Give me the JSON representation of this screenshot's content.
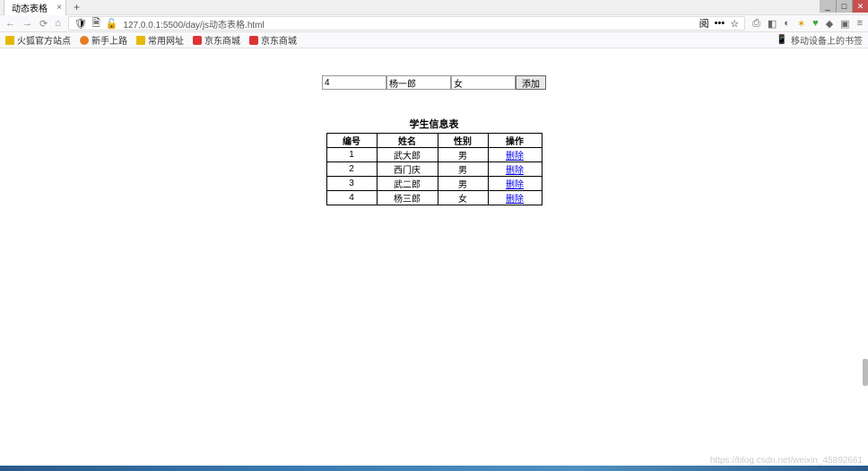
{
  "window": {
    "tab_title": "动态表格"
  },
  "browser": {
    "url": "127.0.0.1:5500/day/js动态表格.html",
    "reader_icon": "阅",
    "ellipsis": "•••",
    "star": "☆",
    "mobile_bookmarks": "移动设备上的书签"
  },
  "bookmarks": [
    {
      "label": "火狐官方站点",
      "icon": "folder"
    },
    {
      "label": "新手上路",
      "icon": "orange"
    },
    {
      "label": "常用网址",
      "icon": "folder"
    },
    {
      "label": "京东商城",
      "icon": "red"
    },
    {
      "label": "京东商城",
      "icon": "red"
    }
  ],
  "form": {
    "id_value": "4",
    "name_value": "杨一郎",
    "gender_value": "女",
    "add_label": "添加"
  },
  "table": {
    "caption": "学生信息表",
    "headers": {
      "id": "编号",
      "name": "姓名",
      "gender": "性别",
      "action": "操作"
    },
    "delete_label": "删除",
    "rows": [
      {
        "id": "1",
        "name": "武大郎",
        "gender": "男"
      },
      {
        "id": "2",
        "name": "西门庆",
        "gender": "男"
      },
      {
        "id": "3",
        "name": "武二郎",
        "gender": "男"
      },
      {
        "id": "4",
        "name": "杨三郎",
        "gender": "女"
      }
    ]
  },
  "watermark": "https://blog.csdn.net/weixin_45892661"
}
